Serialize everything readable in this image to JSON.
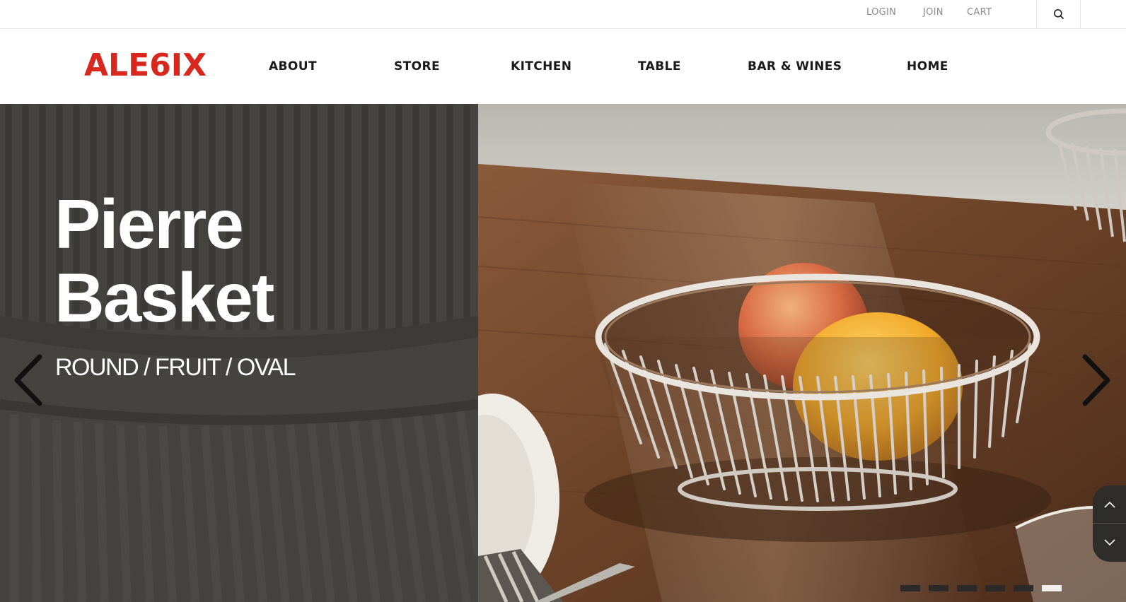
{
  "topbar": {
    "login_label": "LOGIN",
    "join_label": "JOIN",
    "cart_label": "CART",
    "search_icon": "search-icon"
  },
  "header": {
    "logo": "ALE6IX",
    "logo_color": "#d8281e",
    "nav": [
      {
        "label": "ABOUT"
      },
      {
        "label": "STORE"
      },
      {
        "label": "KITCHEN"
      },
      {
        "label": "TABLE"
      },
      {
        "label": "BAR & WINES"
      },
      {
        "label": "HOME"
      }
    ]
  },
  "hero": {
    "title_line1": "Pierre",
    "title_line2": "Basket",
    "subtitle": "ROUND / FRUIT / OVAL",
    "prev_icon": "chevron-left-icon",
    "next_icon": "chevron-right-icon",
    "panel_color": "#454340",
    "slides_total": 6,
    "active_slide": 6
  },
  "scroll_controls": {
    "up_icon": "chevron-up-icon",
    "down_icon": "chevron-down-icon"
  }
}
